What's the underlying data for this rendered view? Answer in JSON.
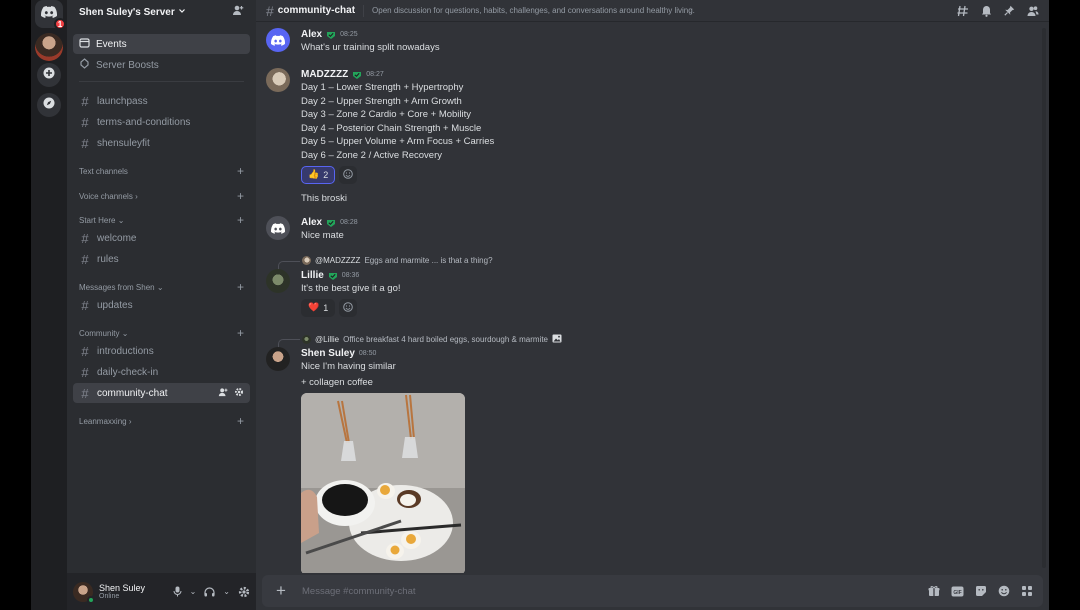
{
  "server": {
    "name": "Shen Suley's Server",
    "notification_count": "1"
  },
  "sidebar": {
    "top_items": [
      {
        "label": "Events"
      },
      {
        "label": "Server Boosts"
      }
    ],
    "channels_top": [
      {
        "label": "launchpass"
      },
      {
        "label": "terms-and-conditions"
      },
      {
        "label": "shensuleyfit"
      }
    ],
    "categories": {
      "text": "Text channels",
      "voice": "Voice channels",
      "start_here": "Start Here",
      "messages_from_shen": "Messages from Shen",
      "community": "Community",
      "leanmaxxing": "Leanmaxxing"
    },
    "start_here_channels": [
      {
        "label": "welcome"
      },
      {
        "label": "rules"
      }
    ],
    "shen_channels": [
      {
        "label": "updates"
      }
    ],
    "community_channels": [
      {
        "label": "introductions"
      },
      {
        "label": "daily-check-in"
      },
      {
        "label": "community-chat"
      }
    ]
  },
  "user": {
    "name": "Shen Suley",
    "status": "Online"
  },
  "channel": {
    "name": "community-chat",
    "topic": "Open discussion for questions, habits, challenges, and conversations around healthy living."
  },
  "messages": [
    {
      "author": "Alex",
      "time": "08:25",
      "lines": [
        "What's ur training split nowadays"
      ]
    },
    {
      "author": "MADZZZZ",
      "time": "08:27",
      "lines": [
        "Day 1 – Lower Strength + Hypertrophy",
        "Day 2 – Upper Strength + Arm Growth",
        "Day 3 – Zone 2 Cardio + Core + Mobility",
        "Day 4 – Posterior Chain Strength + Muscle",
        "Day 5 – Upper Volume + Arm Focus + Carries",
        "Day 6 – Zone 2 / Active Recovery"
      ],
      "reaction": {
        "emoji": "👍",
        "count": "2"
      },
      "followup": "This broski"
    },
    {
      "author": "Alex",
      "time": "08:28",
      "lines": [
        "Nice mate"
      ]
    },
    {
      "reply_to": "@MADZZZZ",
      "reply_text": "Eggs and marmite ... is that a thing?",
      "author": "Lillie",
      "time": "08:36",
      "lines": [
        "It's the best give it a go!"
      ],
      "reaction": {
        "emoji": "❤️",
        "count": "1"
      }
    },
    {
      "reply_to": "@Lillie",
      "reply_text": "Office breakfast 4 hard boiled eggs, sourdough & marmite",
      "author": "Shen Suley",
      "time": "08:50",
      "lines": [
        "Nice I'm having similar",
        "+ collagen coffee"
      ]
    }
  ],
  "composer": {
    "placeholder": "Message #community-chat"
  },
  "colors": {
    "accent": "#5865f2",
    "online": "#23a55a",
    "role_badge": "#23a55a",
    "notification": "#f23f43"
  }
}
